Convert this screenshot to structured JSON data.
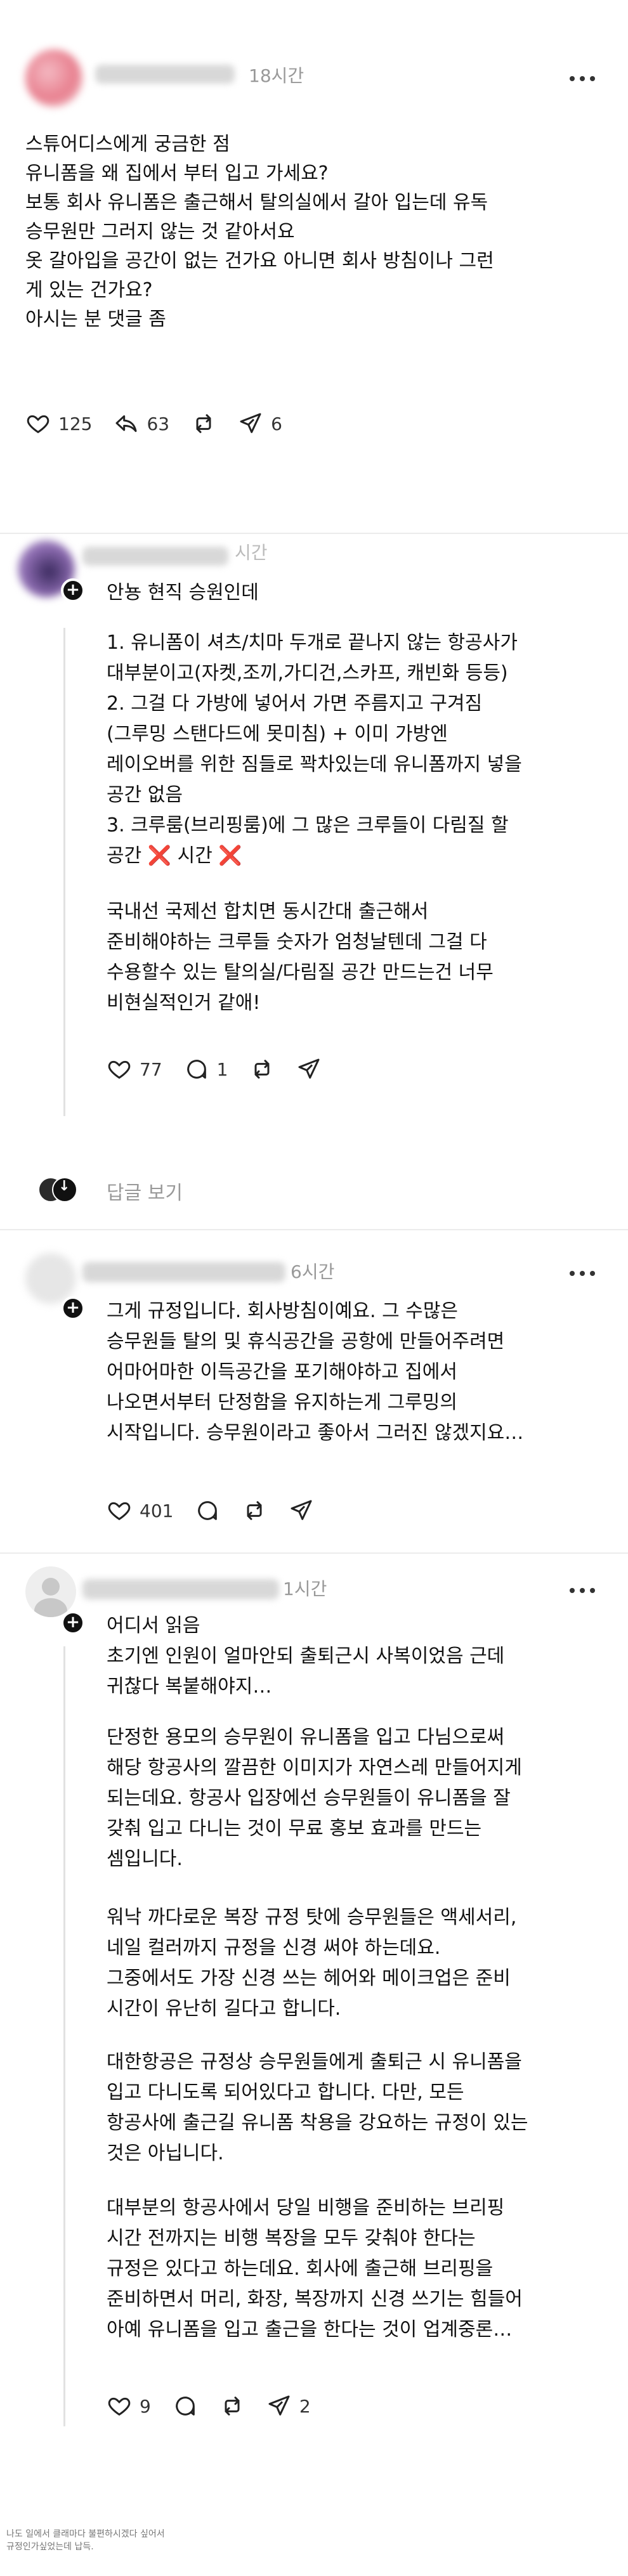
{
  "post": {
    "time": "18시간",
    "text": "스튜어디스에게 궁금한 점\n유니폼을 왜 집에서 부터 입고 가세요?\n보통 회사 유니폼은 출근해서 탈의실에서 갈아 입는데 유독\n승무원만 그러지 않는 것 같아서요\n옷 갈아입을 공간이 없는 건가요 아니면 회사 방침이나 그런\n게 있는 건가요?\n아시는 분 댓글 좀",
    "likes": "125",
    "comments": "63",
    "shares": "6"
  },
  "reply1": {
    "time": "시간",
    "title": "안뇽 현직 승원인데",
    "text1": "1. 유니폼이 셔츠/치마 두개로 끝나지 않는 항공사가\n대부분이고(자켓,조끼,가디건,스카프, 캐빈화 등등)\n2. 그걸 다 가방에 넣어서 가면 주름지고 구겨짐\n(그루밍 스탠다드에 못미침) + 이미 가방엔\n레이오버를 위한 짐들로 꽉차있는데 유니폼까지 넣을\n공간 없음\n3. 크루룸(브리핑룸)에 그 많은 크루들이 다림질 할",
    "text1_last": "공간",
    "cross": "❌",
    "text1_last2": "시간",
    "text2": "국내선 국제선 합치면 동시간대 출근해서\n준비해야하는 크루들 숫자가 엄청날텐데 그걸 다\n수용할수 있는 탈의실/다림질 공간 만드는건 너무\n비현실적인거 같애!",
    "likes": "77",
    "comments": "1",
    "view_replies": "답글 보기"
  },
  "reply2": {
    "time": "6시간",
    "text": "그게 규정입니다. 회사방침이예요. 그 수많은\n승무원들 탈의 및 휴식공간을 공항에 만들어주려면\n어마어마한 이득공간을 포기해야하고 집에서\n나오면서부터 단정함을 유지하는게 그루밍의\n시작입니다. 승무원이라고 좋아서 그러진 않겠지요…",
    "likes": "401"
  },
  "reply3": {
    "time": "1시간",
    "title": "어디서 읽음",
    "p1": "초기엔 인원이 얼마안되 출퇴근시 사복이었음 근데\n귀찮다 복붙해야지…",
    "p2": "단정한 용모의 승무원이 유니폼을 입고 다님으로써\n해당 항공사의 깔끔한 이미지가 자연스레 만들어지게\n되는데요. 항공사 입장에선 승무원들이 유니폼을 잘\n갖춰 입고 다니는 것이 무료 홍보 효과를 만드는\n셈입니다.",
    "p3": "워낙 까다로운 복장 규정 탓에 승무원들은 액세서리,\n네일 컬러까지 규정을 신경 써야 하는데요.\n그중에서도 가장 신경 쓰는 헤어와 메이크업은 준비\n시간이 유난히 길다고 합니다.",
    "p4": "대한항공은 규정상 승무원들에게 출퇴근 시 유니폼을\n입고 다니도록 되어있다고 합니다. 다만, 모든\n항공사에 출근길 유니폼 착용을 강요하는 규정이 있는\n것은 아닙니다.",
    "p5": "대부분의 항공사에서 당일 비행을 준비하는 브리핑\n시간 전까지는 비행 복장을 모두 갖춰야 한다는\n규정은 있다고 하는데요. 회사에 출근해 브리핑을\n준비하면서 머리, 화장, 복장까지 신경 쓰기는 힘들어\n아예 유니폼을 입고 출근을 한다는 것이 업계중론…",
    "likes": "9",
    "shares": "2"
  },
  "footer": {
    "note": "나도 일에서 클래마다 불편하시겠다 싶어서\n규정인가싶었는데 납득."
  },
  "icons": [
    "heart-icon",
    "reply-icon",
    "comment-icon",
    "repost-icon",
    "share-icon",
    "more-icon",
    "person-icon",
    "plus-icon"
  ],
  "colors": {
    "text": "#111111",
    "meta": "#999999",
    "cross": "#d9262b",
    "divider": "#ececec"
  }
}
